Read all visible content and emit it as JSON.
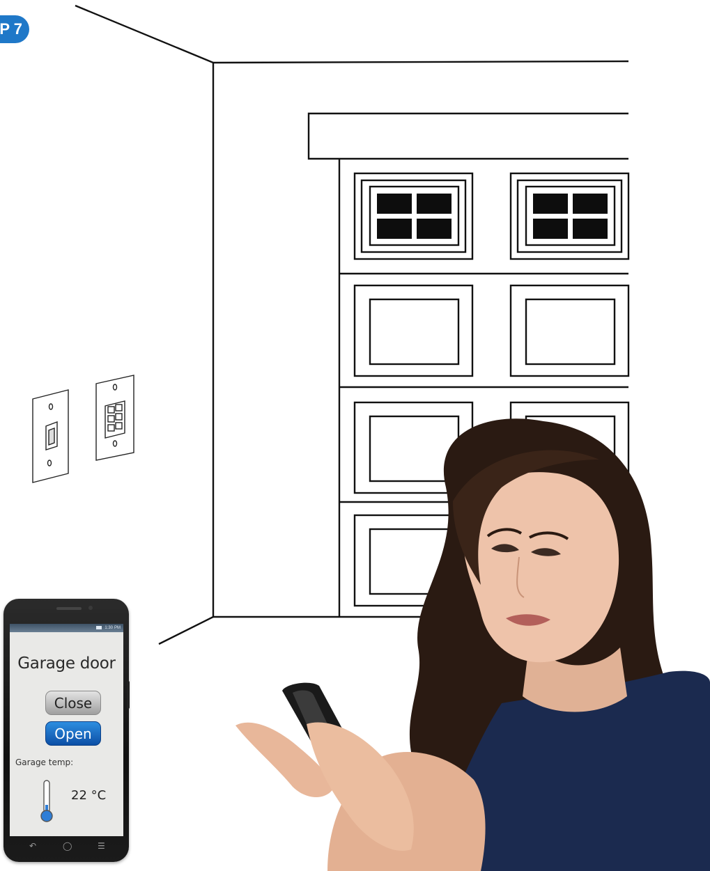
{
  "badge": {
    "text": "P 7"
  },
  "phone_app": {
    "status_time": "1:30",
    "status_ampm": "PM",
    "title": "Garage door",
    "close_label": "Close",
    "open_label": "Open",
    "temp_label": "Garage temp:",
    "temp_value": "22 °C",
    "nav_icons": [
      "back-icon",
      "home-icon",
      "menu-icon"
    ]
  },
  "colors": {
    "badge": "#1f78c8",
    "open_button": "#1565c0",
    "close_button": "#b7b7b7",
    "line_art": "#111111",
    "hair": "#2a1a12",
    "shirt": "#1b2a4f",
    "skin": "#e9bfa6"
  },
  "illustration": {
    "garage_window_panes": 4,
    "switch_plate_buttons": 6
  }
}
